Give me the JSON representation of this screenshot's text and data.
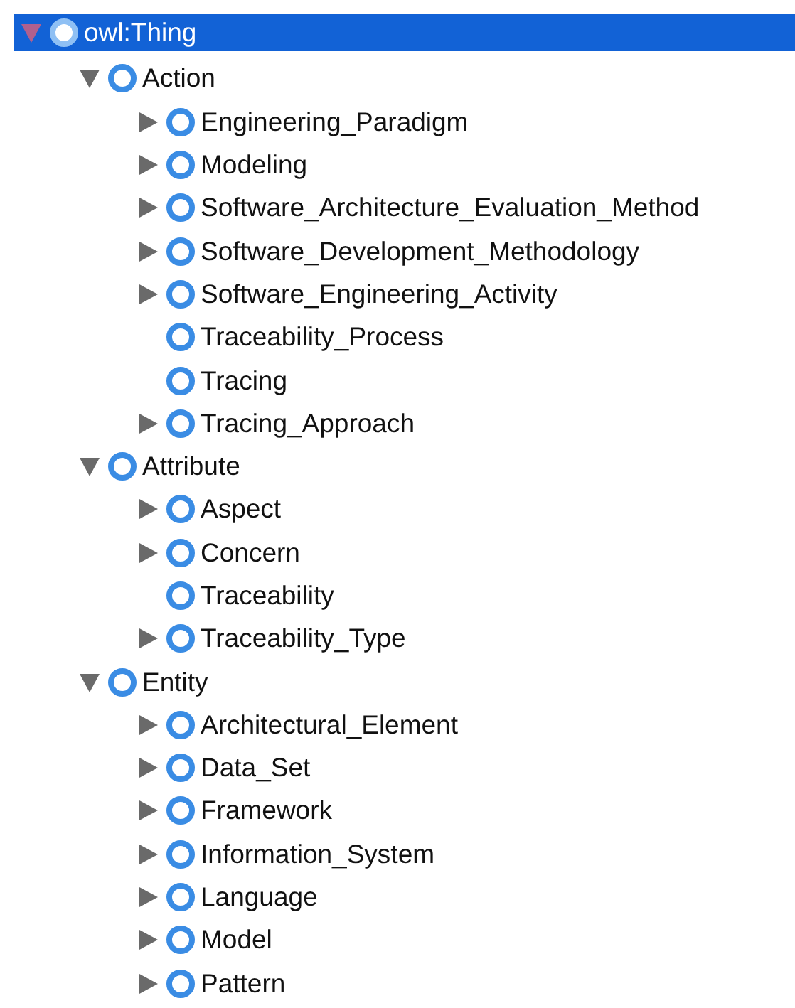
{
  "class_tree": {
    "label": "owl:Thing",
    "kind": "branch",
    "expanded": true,
    "selected": true,
    "children": [
      {
        "label": "Action",
        "kind": "branch",
        "expanded": true,
        "selected": false,
        "children": [
          {
            "label": "Engineering_Paradigm",
            "kind": "branch",
            "expanded": false,
            "selected": false
          },
          {
            "label": "Modeling",
            "kind": "branch",
            "expanded": false,
            "selected": false
          },
          {
            "label": "Software_Architecture_Evaluation_Method",
            "kind": "branch",
            "expanded": false,
            "selected": false
          },
          {
            "label": "Software_Development_Methodology",
            "kind": "branch",
            "expanded": false,
            "selected": false
          },
          {
            "label": "Software_Engineering_Activity",
            "kind": "branch",
            "expanded": false,
            "selected": false
          },
          {
            "label": "Traceability_Process",
            "kind": "leaf",
            "selected": false
          },
          {
            "label": "Tracing",
            "kind": "leaf",
            "selected": false
          },
          {
            "label": "Tracing_Approach",
            "kind": "branch",
            "expanded": false,
            "selected": false
          }
        ]
      },
      {
        "label": "Attribute",
        "kind": "branch",
        "expanded": true,
        "selected": false,
        "children": [
          {
            "label": "Aspect",
            "kind": "branch",
            "expanded": false,
            "selected": false
          },
          {
            "label": "Concern",
            "kind": "branch",
            "expanded": false,
            "selected": false
          },
          {
            "label": "Traceability",
            "kind": "leaf",
            "selected": false
          },
          {
            "label": "Traceability_Type",
            "kind": "branch",
            "expanded": false,
            "selected": false
          }
        ]
      },
      {
        "label": "Entity",
        "kind": "branch",
        "expanded": true,
        "selected": false,
        "children": [
          {
            "label": "Architectural_Element",
            "kind": "branch",
            "expanded": false,
            "selected": false
          },
          {
            "label": "Data_Set",
            "kind": "branch",
            "expanded": false,
            "selected": false
          },
          {
            "label": "Framework",
            "kind": "branch",
            "expanded": false,
            "selected": false
          },
          {
            "label": "Information_System",
            "kind": "branch",
            "expanded": false,
            "selected": false
          },
          {
            "label": "Language",
            "kind": "branch",
            "expanded": false,
            "selected": false
          },
          {
            "label": "Model",
            "kind": "branch",
            "expanded": false,
            "selected": false
          },
          {
            "label": "Pattern",
            "kind": "branch",
            "expanded": false,
            "selected": false
          }
        ]
      }
    ]
  }
}
